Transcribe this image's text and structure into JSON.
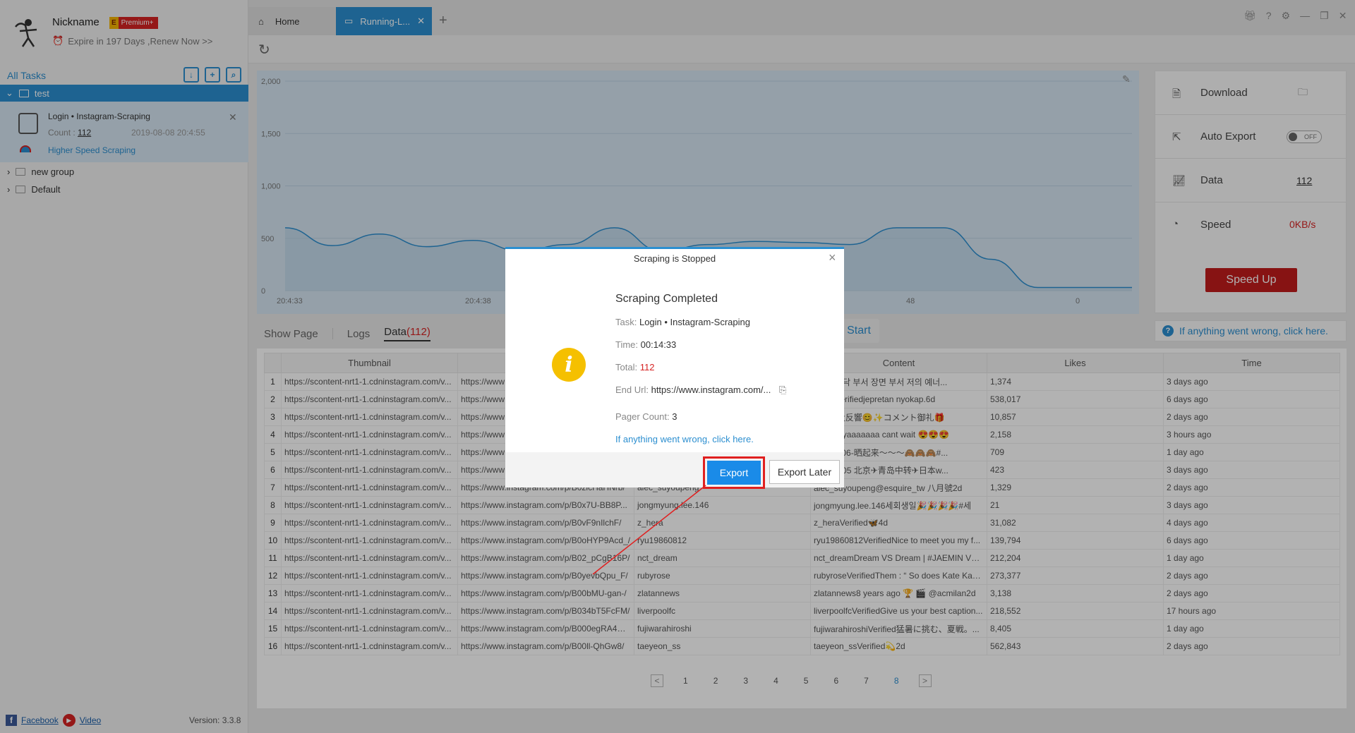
{
  "user": {
    "nickname": "Nickname",
    "badge_letter": "E",
    "badge_text": "Premium+",
    "expire": "Expire in 197 Days ,Renew Now >>"
  },
  "sidebar": {
    "all_tasks": "All Tasks",
    "group_open": "test",
    "task": {
      "title": "Login • Instagram-Scraping",
      "count_label": "Count :",
      "count": "112",
      "date": "2019-08-08 20:4:55",
      "speed": "Higher Speed Scraping"
    },
    "groups": [
      "new group",
      "Default"
    ]
  },
  "footer": {
    "facebook": "Facebook",
    "video": "Video",
    "version": "Version: 3.3.8"
  },
  "tabs": {
    "home": "Home",
    "running": "Running-L..."
  },
  "chart_data": {
    "type": "area",
    "x": [
      "20:4:33",
      "20:4:38",
      "",
      "",
      "",
      "",
      "48",
      "0"
    ],
    "y_ticks": [
      0,
      500,
      1000,
      1500,
      2000
    ],
    "ylim": [
      0,
      2000
    ],
    "values": [
      600,
      430,
      540,
      420,
      480,
      380,
      440,
      600,
      380,
      440,
      470,
      460,
      440,
      600,
      600,
      300,
      30,
      30,
      30
    ],
    "grid": true,
    "color": "#2c8fd0"
  },
  "subtabs": {
    "show_page": "Show Page",
    "logs": "Logs",
    "data": "Data",
    "data_count": "(112)"
  },
  "start": "Start",
  "right_panel": {
    "download": "Download",
    "auto_export": "Auto Export",
    "toggle": "OFF",
    "data": "Data",
    "data_value": "112",
    "speed": "Speed",
    "speed_value": "0KB/s",
    "speed_up": "Speed Up",
    "help": "If anything went wrong, click here."
  },
  "table": {
    "headers": [
      "",
      "Thumbnail",
      "",
      "",
      "Content",
      "Likes",
      "Time"
    ],
    "rows": [
      [
        "1",
        "https://scontent-nrt1-1.cdninstagram.com/v...",
        "https://www",
        "",
        "on_sr바닥 부서 장면 부서 저의 예너...",
        "1,374",
        "3 days ago"
      ],
      [
        "2",
        "https://scontent-nrt1-1.cdninstagram.com/v...",
        "https://www",
        "",
        "zar20Verifiedjepretan nyokap.6d",
        "538,017",
        "6 days ago"
      ],
      [
        "3",
        "https://scontent-nrt1-1.cdninstagram.com/v...",
        "https://www",
        "",
        "_gaya大反響😊✨コメント御礼🎁",
        "10,857",
        "2 days ago"
      ],
      [
        "4",
        "https://scontent-nrt1-1.cdninstagram.com/v...",
        "https://www",
        "",
        "yonggKyaaaaaaa cant wait 😍😍😍",
        "2,158",
        "3 hours ago"
      ],
      [
        "5",
        "https://scontent-nrt1-1.cdninstagram.com/v...",
        "https://www",
        "",
        "lever0406-晒起来～～～🙈🙈🙈#...",
        "709",
        "1 day ago"
      ],
      [
        "6",
        "https://scontent-nrt1-1.cdninstagram.com/v...",
        "https://www",
        "",
        "77190805 北京✈青岛中转✈日本w...",
        "423",
        "3 days ago"
      ],
      [
        "7",
        "https://scontent-nrt1-1.cdninstagram.com/v...",
        "https://www.instagram.com/p/B0zlcHaHNrb/",
        "alec_suyoupeng",
        "alec_suyoupeng@esquire_tw 八月號2d",
        "1,329",
        "2 days ago"
      ],
      [
        "8",
        "https://scontent-nrt1-1.cdninstagram.com/v...",
        "https://www.instagram.com/p/B0x7U-BB8P...",
        "jongmyung.lee.146",
        "jongmyung.lee.146세회생일🎉🎉🎉🎉#세",
        "21",
        "3 days ago"
      ],
      [
        "9",
        "https://scontent-nrt1-1.cdninstagram.com/v...",
        "https://www.instagram.com/p/B0vF9nIlchF/",
        "z_hera",
        "z_heraVerified🦋4d",
        "31,082",
        "4 days ago"
      ],
      [
        "10",
        "https://scontent-nrt1-1.cdninstagram.com/v...",
        "https://www.instagram.com/p/B0oHYP9Acd_/",
        "ryu19860812",
        "ryu19860812VerifiedNice to meet you my f...",
        "139,794",
        "6 days ago"
      ],
      [
        "11",
        "https://scontent-nrt1-1.cdninstagram.com/v...",
        "https://www.instagram.com/p/B02_pCgB16P/",
        "nct_dream",
        "nct_dreamDream VS Dream | #JAEMIN VS...",
        "212,204",
        "1 day ago"
      ],
      [
        "12",
        "https://scontent-nrt1-1.cdninstagram.com/v...",
        "https://www.instagram.com/p/B0yevbQpu_F/",
        "rubyrose",
        "rubyroseVerifiedThem : “ So does Kate Kan...",
        "273,377",
        "2 days ago"
      ],
      [
        "13",
        "https://scontent-nrt1-1.cdninstagram.com/v...",
        "https://www.instagram.com/p/B00bMU-gan-/",
        "zlatannews",
        "zlatannews8 years ago 🏆 🎬 @acmilan2d",
        "3,138",
        "2 days ago"
      ],
      [
        "14",
        "https://scontent-nrt1-1.cdninstagram.com/v...",
        "https://www.instagram.com/p/B034bT5FcFM/",
        "liverpoolfc",
        "liverpoolfcVerifiedGive us your best caption...",
        "218,552",
        "17 hours ago"
      ],
      [
        "15",
        "https://scontent-nrt1-1.cdninstagram.com/v...",
        "https://www.instagram.com/p/B000egRA4W...",
        "fujiwarahiroshi",
        "fujiwarahiroshiVerified猛暑に挑む、夏戦。...",
        "8,405",
        "1 day ago"
      ],
      [
        "16",
        "https://scontent-nrt1-1.cdninstagram.com/v...",
        "https://www.instagram.com/p/B00ll-QhGw8/",
        "taeyeon_ss",
        "taeyeon_ssVerified💫2d",
        "562,843",
        "2 days ago"
      ]
    ]
  },
  "pager": {
    "prev": "<",
    "next": ">",
    "pages": [
      "1",
      "2",
      "3",
      "4",
      "5",
      "6",
      "7",
      "8"
    ],
    "current": "8"
  },
  "dialog": {
    "title": "Scraping is Stopped",
    "heading": "Scraping Completed",
    "task_label": "Task:",
    "task_value": "Login • Instagram-Scraping",
    "time_label": "Time:",
    "time_value": "00:14:33",
    "total_label": "Total:",
    "total_value": "112",
    "end_label": "End Url:",
    "end_value": "https://www.instagram.com/...",
    "pager_label": "Pager Count:",
    "pager_value": "3",
    "help": "If anything went wrong, click here.",
    "export": "Export",
    "later": "Export Later"
  }
}
